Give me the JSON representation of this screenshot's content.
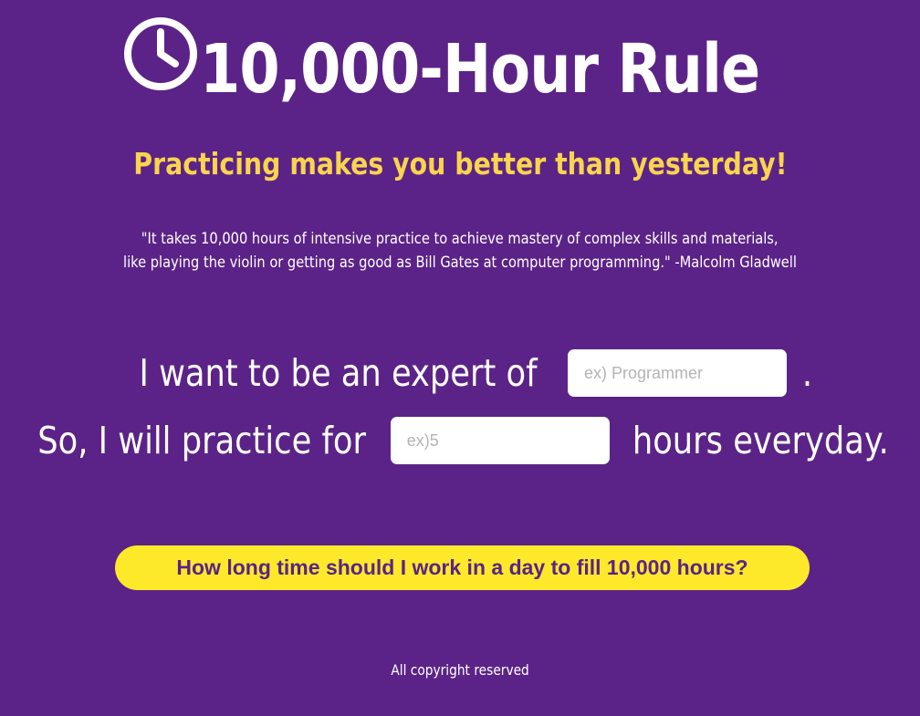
{
  "header": {
    "title": "10,000-Hour Rule",
    "title_icon": "clock-icon"
  },
  "subtitle": "Practicing makes you better than yesterday!",
  "quote": {
    "line1": "\"It takes 10,000 hours of intensive practice to achieve mastery of complex skills and materials,",
    "line2": "like playing the violin or getting as good as Bill Gates at computer programming.\" -Malcolm Gladwell"
  },
  "form": {
    "row1_before": "I want to be an expert of",
    "field_expert_placeholder": "ex) Programmer",
    "field_expert_value": "",
    "row1_after": ".",
    "row2_before": "So, I will practice for",
    "field_hours_placeholder": "ex)5",
    "field_hours_value": "",
    "row2_after": "hours everyday."
  },
  "cta": {
    "label": "How long time should I work in a day to fill 10,000 hours?"
  },
  "footer": {
    "text": "All copyright reserved"
  },
  "colors": {
    "background": "#5b2387",
    "accent_yellow": "#f9d44d",
    "button_yellow": "#fde92a",
    "text": "#ffffff"
  }
}
